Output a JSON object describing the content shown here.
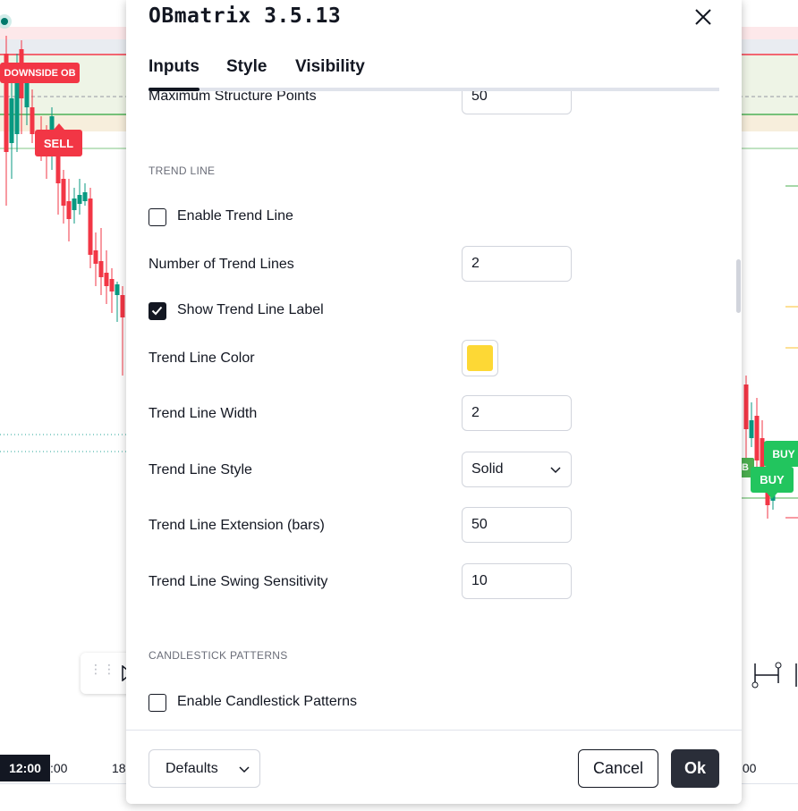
{
  "chart": {
    "labels": {
      "downside_ob": "DOWNSIDE OB",
      "sell": "SELL",
      "buy_top": "BUY",
      "buy": "BUY",
      "ob_fragment": "B"
    },
    "time_axis": {
      "current_time": "12:00",
      "left_tick": ":00",
      "middle_tick": "18",
      "right_tick": ":00"
    },
    "colors": {
      "bear": "#f23645",
      "bull": "#089981",
      "signal_buy": "#22c55e"
    }
  },
  "dialog": {
    "title": "OBmatrix 3.5.13",
    "tabs": [
      {
        "label": "Inputs",
        "active": true
      },
      {
        "label": "Style",
        "active": false
      },
      {
        "label": "Visibility",
        "active": false
      }
    ],
    "rows": {
      "max_structure_points": {
        "label": "Maximum Structure Points",
        "value": "50"
      },
      "trend_line_section": "TREND LINE",
      "enable_trend_line": {
        "label": "Enable Trend Line",
        "checked": false
      },
      "number_trend_lines": {
        "label": "Number of Trend Lines",
        "value": "2"
      },
      "show_trend_label": {
        "label": "Show Trend Line Label",
        "checked": true
      },
      "trend_line_color": {
        "label": "Trend Line Color",
        "color": "#fdd835"
      },
      "trend_line_width": {
        "label": "Trend Line Width",
        "value": "2"
      },
      "trend_line_style": {
        "label": "Trend Line Style",
        "value": "Solid"
      },
      "trend_line_extension": {
        "label": "Trend Line Extension (bars)",
        "value": "50"
      },
      "trend_line_swing": {
        "label": "Trend Line Swing Sensitivity",
        "value": "10"
      },
      "candlestick_section": "CANDLESTICK PATTERNS",
      "enable_candlestick": {
        "label": "Enable Candlestick Patterns",
        "checked": false
      }
    },
    "footer": {
      "defaults_label": "Defaults",
      "cancel_label": "Cancel",
      "ok_label": "Ok"
    }
  }
}
